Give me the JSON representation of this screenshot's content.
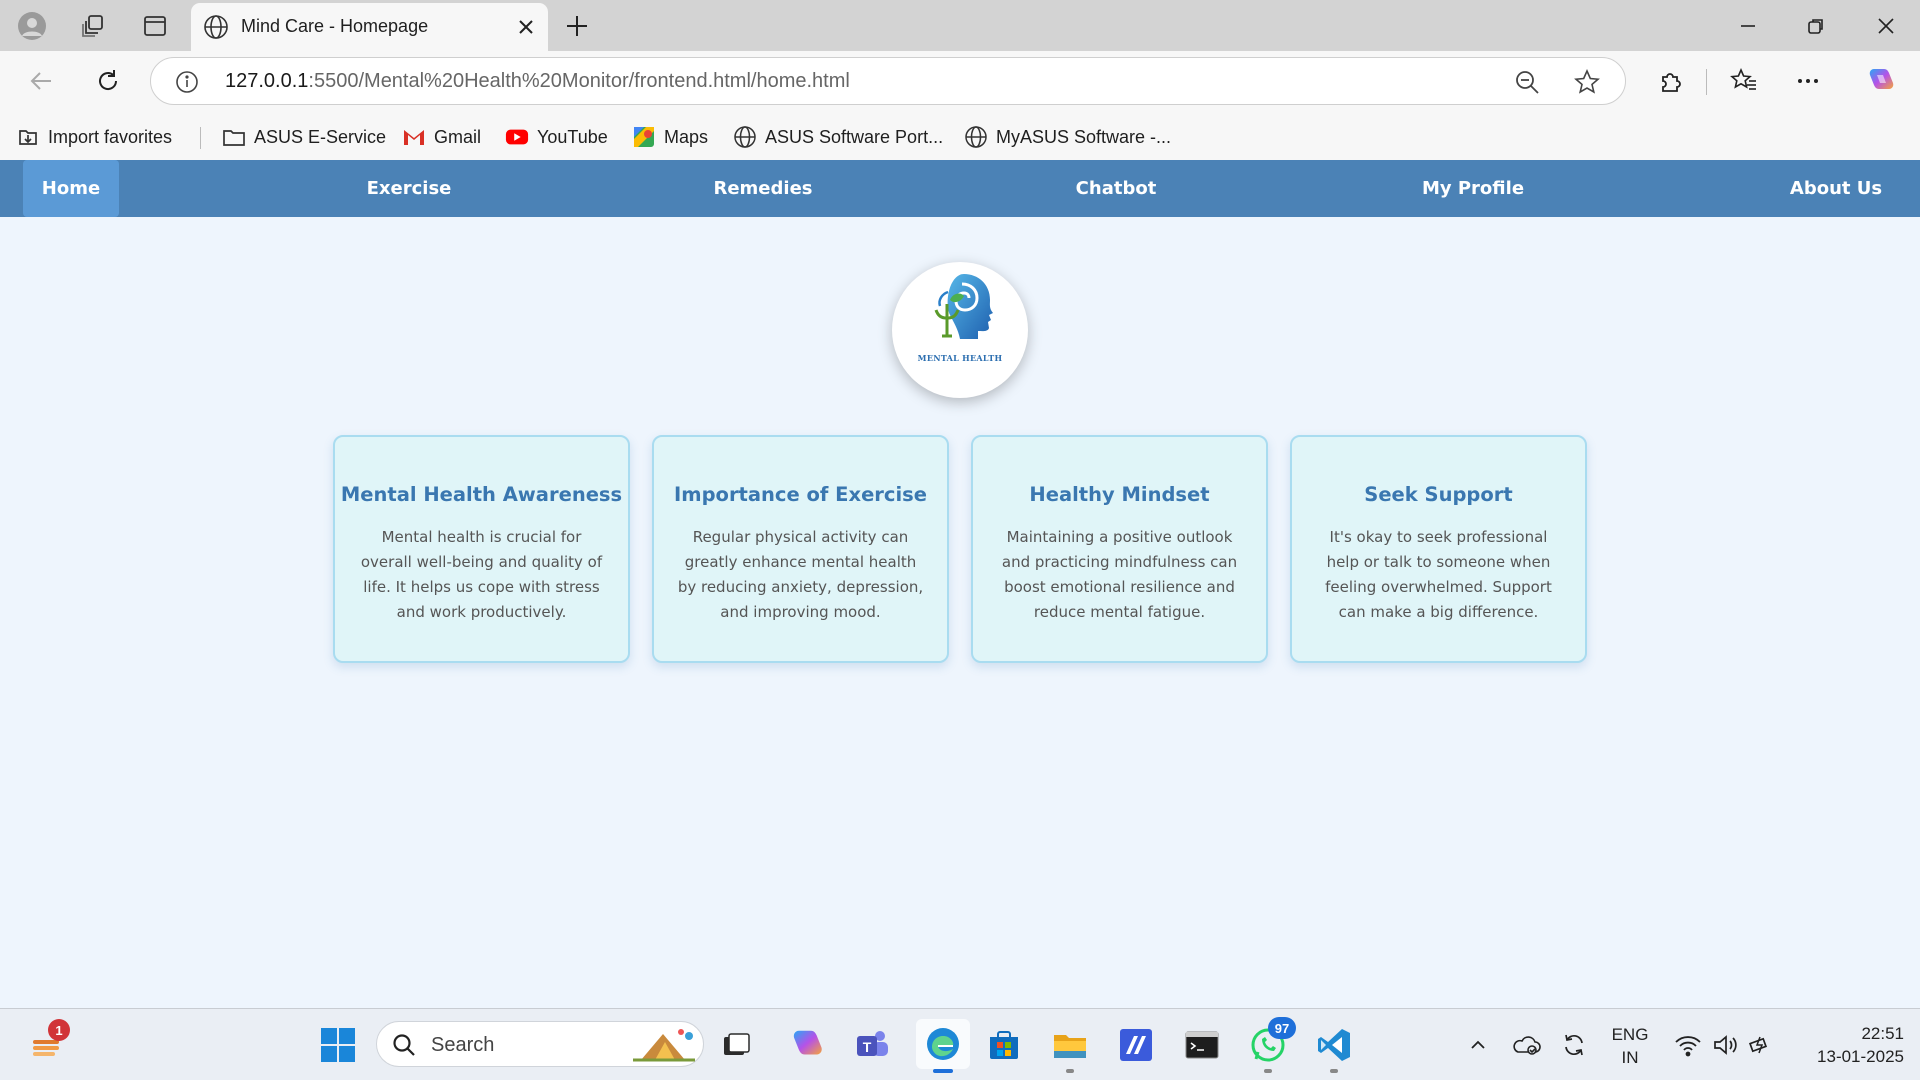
{
  "browser": {
    "tab_title": "Mind Care - Homepage",
    "url_host": "127.0.0.1",
    "url_path": ":5500/Mental%20Health%20Monitor/frontend.html/home.html",
    "favorites": [
      {
        "label": "Import favorites",
        "icon": "import-icon"
      },
      {
        "label": "ASUS E-Service",
        "icon": "folder-icon"
      },
      {
        "label": "Gmail",
        "icon": "gmail-icon"
      },
      {
        "label": "YouTube",
        "icon": "youtube-icon"
      },
      {
        "label": "Maps",
        "icon": "maps-icon"
      },
      {
        "label": "ASUS Software Port...",
        "icon": "globe-icon"
      },
      {
        "label": "MyASUS Software -...",
        "icon": "globe-icon"
      }
    ]
  },
  "nav": {
    "items": [
      "Home",
      "Exercise",
      "Remedies",
      "Chatbot",
      "My Profile",
      "About Us"
    ],
    "active": "Home",
    "bg_color": "#4b82b6",
    "active_color": "#5b9ad6"
  },
  "logo": {
    "caption": "MENTAL HEALTH"
  },
  "cards": [
    {
      "title": "Mental Health Awareness",
      "body": "Mental health is crucial for overall well-being and quality of life. It helps us cope with stress and work productively."
    },
    {
      "title": "Importance of Exercise",
      "body": "Regular physical activity can greatly enhance mental health by reducing anxiety, depression, and improving mood."
    },
    {
      "title": "Healthy Mindset",
      "body": "Maintaining a positive outlook and practicing mindfulness can boost emotional resilience and reduce mental fatigue."
    },
    {
      "title": "Seek Support",
      "body": "It's okay to seek professional help or talk to someone when feeling overwhelmed. Support can make a big difference."
    }
  ],
  "taskbar": {
    "search_placeholder": "Search",
    "widgets_badge": "1",
    "whatsapp_badge": "97",
    "lang_line1": "ENG",
    "lang_line2": "IN",
    "time": "22:51",
    "date": "13-01-2025"
  }
}
